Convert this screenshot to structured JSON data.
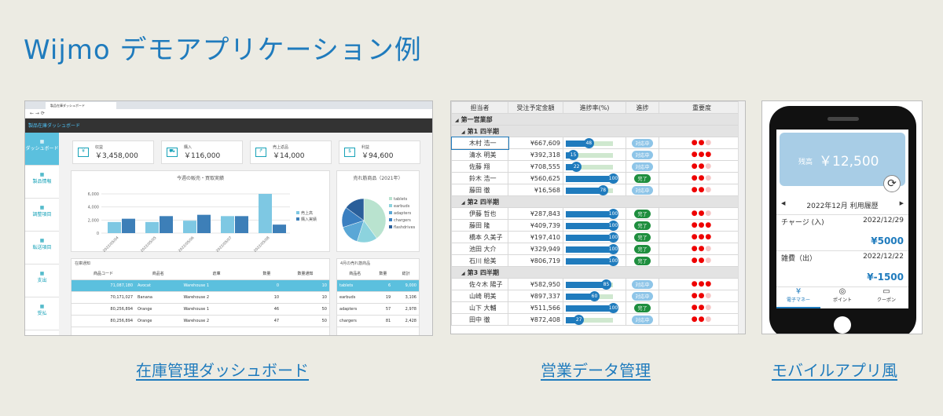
{
  "page_title": "Wijmo デモアプリケーション例",
  "captions": {
    "dashboard": "在庫管理ダッシュボード",
    "sales": "営業データ管理",
    "mobile": "モバイルアプリ風"
  },
  "dashboard": {
    "tab_title": "製品在庫ダッシュボード",
    "app_title": "製品在庫ダッシュボード",
    "sidebar": [
      {
        "label": "ダッシュボード",
        "active": true
      },
      {
        "label": "製品情報"
      },
      {
        "label": "調整項目"
      },
      {
        "label": "転送項目"
      },
      {
        "label": "支出"
      },
      {
        "label": "受払"
      }
    ],
    "kpis": [
      {
        "label": "収益",
        "value": "￥3,458,000",
        "icon": "money-icon"
      },
      {
        "label": "購入",
        "value": "￥116,000",
        "icon": "cart-icon"
      },
      {
        "label": "売上返品",
        "value": "￥14,000",
        "icon": "return-icon"
      },
      {
        "label": "利益",
        "value": "￥94,600",
        "icon": "profit-icon"
      }
    ],
    "bar_panel_title": "今週の販売・買取実績",
    "pie_panel_title": "売れ筋商品（2021年）",
    "stock_panel_title": "在庫通知",
    "stock_columns": [
      "商品コード",
      "商品名",
      "倉庫",
      "数量",
      "数量通知"
    ],
    "stock_rows": [
      [
        "71,087,180",
        "Avocat",
        "Warehouse 1",
        "0",
        "10"
      ],
      [
        "70,171,027",
        "Banana",
        "Warehouse 2",
        "10",
        "10"
      ],
      [
        "80,256,894",
        "Orange",
        "Warehouse 1",
        "46",
        "50"
      ],
      [
        "80,256,894",
        "Orange",
        "Warehouse 2",
        "47",
        "50"
      ]
    ],
    "top_panel_title": "4月の売れ筋商品",
    "top_columns": [
      "商品名",
      "数量",
      "総計"
    ],
    "top_rows": [
      [
        "tablets",
        "6",
        "9,000"
      ],
      [
        "earbuds",
        "19",
        "3,106"
      ],
      [
        "adapters",
        "57",
        "2,978"
      ],
      [
        "chargers",
        "81",
        "2,428"
      ]
    ]
  },
  "chart_data": [
    {
      "type": "bar",
      "title": "今週の販売・買取実績",
      "categories": [
        "2022/05/04",
        "2022/05/05",
        "2022/05/06",
        "2022/05/07",
        "2022/05/08"
      ],
      "series": [
        {
          "name": "売上高",
          "values": [
            1700,
            1700,
            1900,
            2600,
            6000
          ],
          "color": "#7ec8e3"
        },
        {
          "name": "購入実績",
          "values": [
            2200,
            2600,
            2800,
            2600,
            1300
          ],
          "color": "#3d7fb8"
        }
      ],
      "ylim": [
        0,
        6000
      ],
      "yticks": [
        "0",
        "2,000",
        "4,000",
        "6,000"
      ]
    },
    {
      "type": "pie",
      "title": "売れ筋商品（2021年）",
      "categories": [
        "tablets",
        "earbuds",
        "adapters",
        "chargers",
        "flashdrives"
      ],
      "values": [
        40,
        15,
        15,
        15,
        15
      ],
      "colors": [
        "#b9e3cf",
        "#8cd3de",
        "#5aa7d6",
        "#3a7fc0",
        "#2a5f9a"
      ]
    }
  ],
  "sales": {
    "columns": [
      "担当者",
      "受注予定金額",
      "進捗率(%)",
      "進捗",
      "重要度"
    ],
    "groups": [
      {
        "label": "第一営業部",
        "level": 0
      },
      {
        "label": "第1 四半期",
        "level": 1,
        "rows": [
          {
            "name": "木村 浩一",
            "amount": "¥667,609",
            "pct": 48,
            "status": "対応中",
            "imp": 2
          },
          {
            "name": "清水 明美",
            "amount": "¥392,318",
            "pct": 15,
            "status": "対応中",
            "imp": 3
          },
          {
            "name": "佐藤 翔",
            "amount": "¥708,555",
            "pct": 22,
            "status": "対応中",
            "imp": 2
          },
          {
            "name": "鈴木 浩一",
            "amount": "¥560,625",
            "pct": 100,
            "status": "完了",
            "imp": 2
          },
          {
            "name": "藤田 徹",
            "amount": "¥16,568",
            "pct": 78,
            "status": "対応中",
            "imp": 2
          }
        ]
      },
      {
        "label": "第2 四半期",
        "level": 1,
        "rows": [
          {
            "name": "伊藤 哲也",
            "amount": "¥287,843",
            "pct": 100,
            "status": "完了",
            "imp": 2
          },
          {
            "name": "藤田 隆",
            "amount": "¥409,739",
            "pct": 100,
            "status": "完了",
            "imp": 3
          },
          {
            "name": "橋本 久美子",
            "amount": "¥197,410",
            "pct": 100,
            "status": "完了",
            "imp": 3
          },
          {
            "name": "池田 大介",
            "amount": "¥329,949",
            "pct": 100,
            "status": "完了",
            "imp": 2
          },
          {
            "name": "石川 絵美",
            "amount": "¥806,719",
            "pct": 100,
            "status": "完了",
            "imp": 2
          }
        ]
      },
      {
        "label": "第3 四半期",
        "level": 1,
        "rows": [
          {
            "name": "佐々木 陽子",
            "amount": "¥582,950",
            "pct": 85,
            "status": "対応中",
            "imp": 3
          },
          {
            "name": "山崎 明美",
            "amount": "¥897,337",
            "pct": 60,
            "status": "対応中",
            "imp": 2
          },
          {
            "name": "山下 大輔",
            "amount": "¥511,566",
            "pct": 100,
            "status": "完了",
            "imp": 2
          },
          {
            "name": "田中 徹",
            "amount": "¥872,408",
            "pct": 27,
            "status": "対応中",
            "imp": 2
          }
        ]
      }
    ]
  },
  "mobile": {
    "balance_label": "残高",
    "balance_value": "￥12,500",
    "month": "2022年12月 利用履歴",
    "entries": [
      {
        "label": "チャージ (入)",
        "date": "2022/12/29",
        "amount": "¥5000"
      },
      {
        "label": "雑費（出）",
        "date": "2022/12/22",
        "amount": "¥-1500"
      }
    ],
    "tabs": [
      "電子マネー",
      "ポイント",
      "クーポン"
    ]
  }
}
